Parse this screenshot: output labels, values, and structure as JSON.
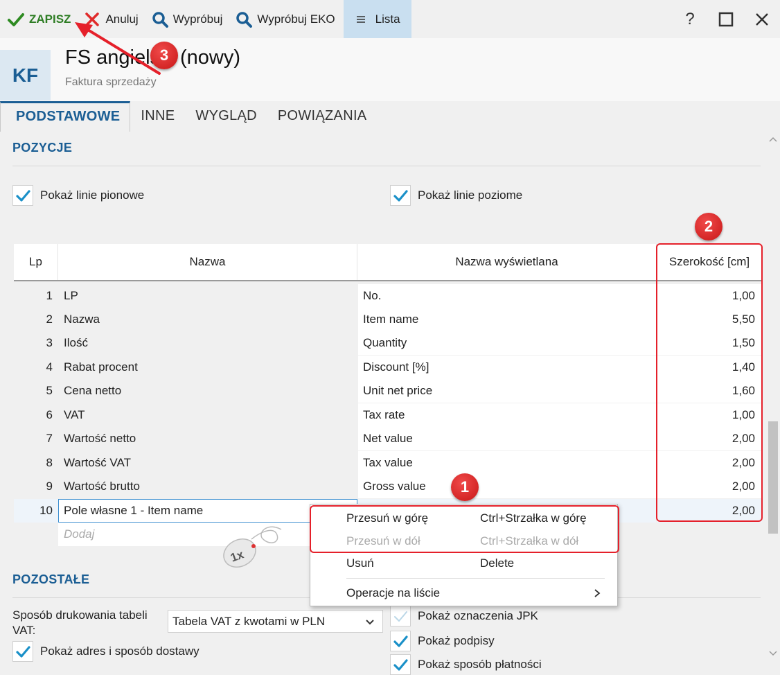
{
  "toolbar": {
    "save_label": "ZAPISZ",
    "cancel_label": "Anuluj",
    "try_label": "Wypróbuj",
    "try_eko_label": "Wypróbuj EKO",
    "list_label": "Lista",
    "help_label": "?",
    "maximize_label": "☐",
    "close_label": "✕"
  },
  "header": {
    "badge": "KF",
    "title": "FS angielski (nowy)",
    "subtitle": "Faktura sprzedaży"
  },
  "tabs": [
    {
      "label": "PODSTAWOWE",
      "active": true
    },
    {
      "label": "INNE",
      "active": false
    },
    {
      "label": "WYGLĄD",
      "active": false
    },
    {
      "label": "POWIĄZANIA",
      "active": false
    }
  ],
  "pozycje": {
    "title": "POZYCJE",
    "vertical_lines_label": "Pokaż linie pionowe",
    "vertical_lines_checked": true,
    "horizontal_lines_label": "Pokaż linie poziome",
    "horizontal_lines_checked": true
  },
  "grid": {
    "columns": [
      "Lp",
      "Nazwa",
      "Nazwa wyświetlana",
      "Szerokość [cm]"
    ],
    "rows": [
      {
        "lp": "1",
        "name": "LP",
        "display": "No.",
        "width": "1,00"
      },
      {
        "lp": "2",
        "name": "Nazwa",
        "display": "Item name",
        "width": "5,50"
      },
      {
        "lp": "3",
        "name": "Ilość",
        "display": "Quantity",
        "width": "1,50"
      },
      {
        "lp": "4",
        "name": "Rabat procent",
        "display": "Discount [%]",
        "width": "1,40"
      },
      {
        "lp": "5",
        "name": "Cena netto",
        "display": "Unit net price",
        "width": "1,60"
      },
      {
        "lp": "6",
        "name": "VAT",
        "display": "Tax rate",
        "width": "1,00"
      },
      {
        "lp": "7",
        "name": "Wartość netto",
        "display": "Net value",
        "width": "2,00"
      },
      {
        "lp": "8",
        "name": "Wartość VAT",
        "display": "Tax value",
        "width": "2,00"
      },
      {
        "lp": "9",
        "name": "Wartość brutto",
        "display": "Gross value",
        "width": "2,00"
      },
      {
        "lp": "10",
        "name": "Pole własne 1 - Item name",
        "display": "",
        "width": "2,00"
      }
    ],
    "add_placeholder": "Dodaj"
  },
  "context_menu": {
    "items": [
      {
        "label": "Przesuń w górę",
        "shortcut": "Ctrl+Strzałka w górę",
        "enabled": true
      },
      {
        "label": "Przesuń w dół",
        "shortcut": "Ctrl+Strzałka w dół",
        "enabled": false
      },
      {
        "label": "Usuń",
        "shortcut": "Delete",
        "enabled": true
      },
      {
        "label": "Operacje na liście",
        "shortcut": "",
        "enabled": true
      }
    ]
  },
  "pozostale": {
    "title": "POZOSTAŁE",
    "vat_table_label": "Sposób drukowania tabeli VAT:",
    "vat_table_value": "Tabela VAT z kwotami w PLN",
    "show_delivery_label": "Pokaż adres i sposób dostawy",
    "show_jpk_label": "Pokaż oznaczenia JPK",
    "show_signatures_label": "Pokaż podpisy",
    "show_payment_label": "Pokaż sposób płatności"
  },
  "annotations": {
    "badge_1": "1",
    "badge_2": "2",
    "badge_3": "3",
    "mouse_label": "1x"
  },
  "colors": {
    "accent": "#1b5e94",
    "save_green": "#2e7d24",
    "annotation_red": "#e5202a"
  }
}
